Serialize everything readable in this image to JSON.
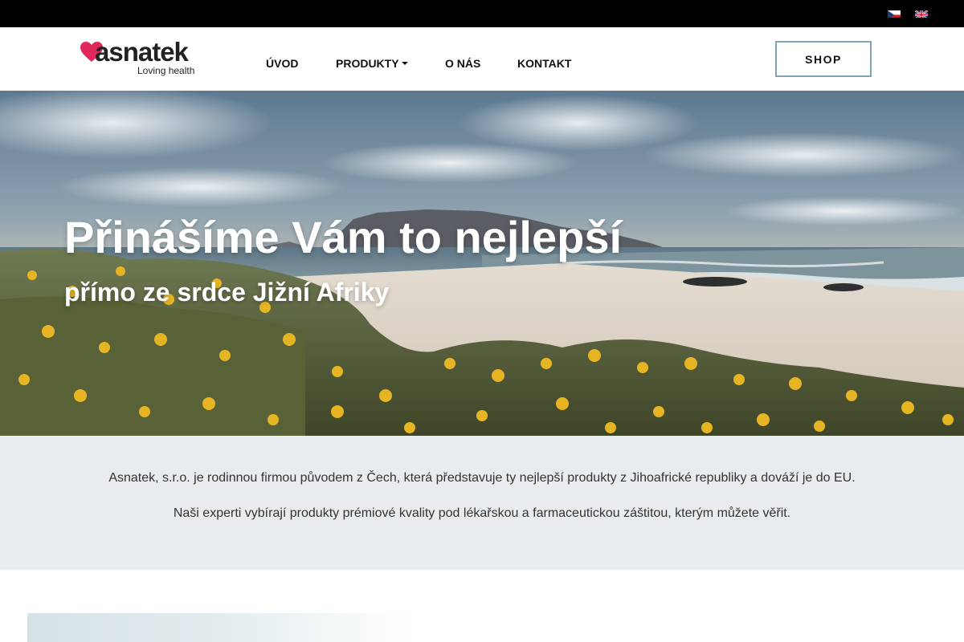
{
  "topbar": {
    "languages": [
      {
        "code": "cs",
        "icon": "czech-flag-icon"
      },
      {
        "code": "en",
        "icon": "uk-flag-icon"
      }
    ]
  },
  "header": {
    "logo_text": "asnatek",
    "logo_tagline": "Loving health",
    "logo_icon": "heart-icon",
    "nav": {
      "uvod": "ÚVOD",
      "produkty": "PRODUKTY",
      "onas": "O NÁS",
      "kontakt": "KONTAKT"
    },
    "shop_label": "SHOP"
  },
  "hero": {
    "title": "Přinášíme Vám to nejlepší",
    "subtitle": "přímo ze srdce Jižní Afriky"
  },
  "intro": {
    "paragraph1": "Asnatek, s.r.o. je rodinnou firmou původem z Čech, která představuje ty nejlepší produkty z Jihoafrické republiky a dováží je do EU.",
    "paragraph2": "Naši experti vybírají produkty prémiové kvality pod lékařskou a farmaceutickou záštitou, kterým můžete věřit."
  },
  "colors": {
    "topbar": "#000000",
    "shop_border": "#7ea6b0",
    "intro_bg": "#e8ecef",
    "heart": "#e0285a"
  }
}
